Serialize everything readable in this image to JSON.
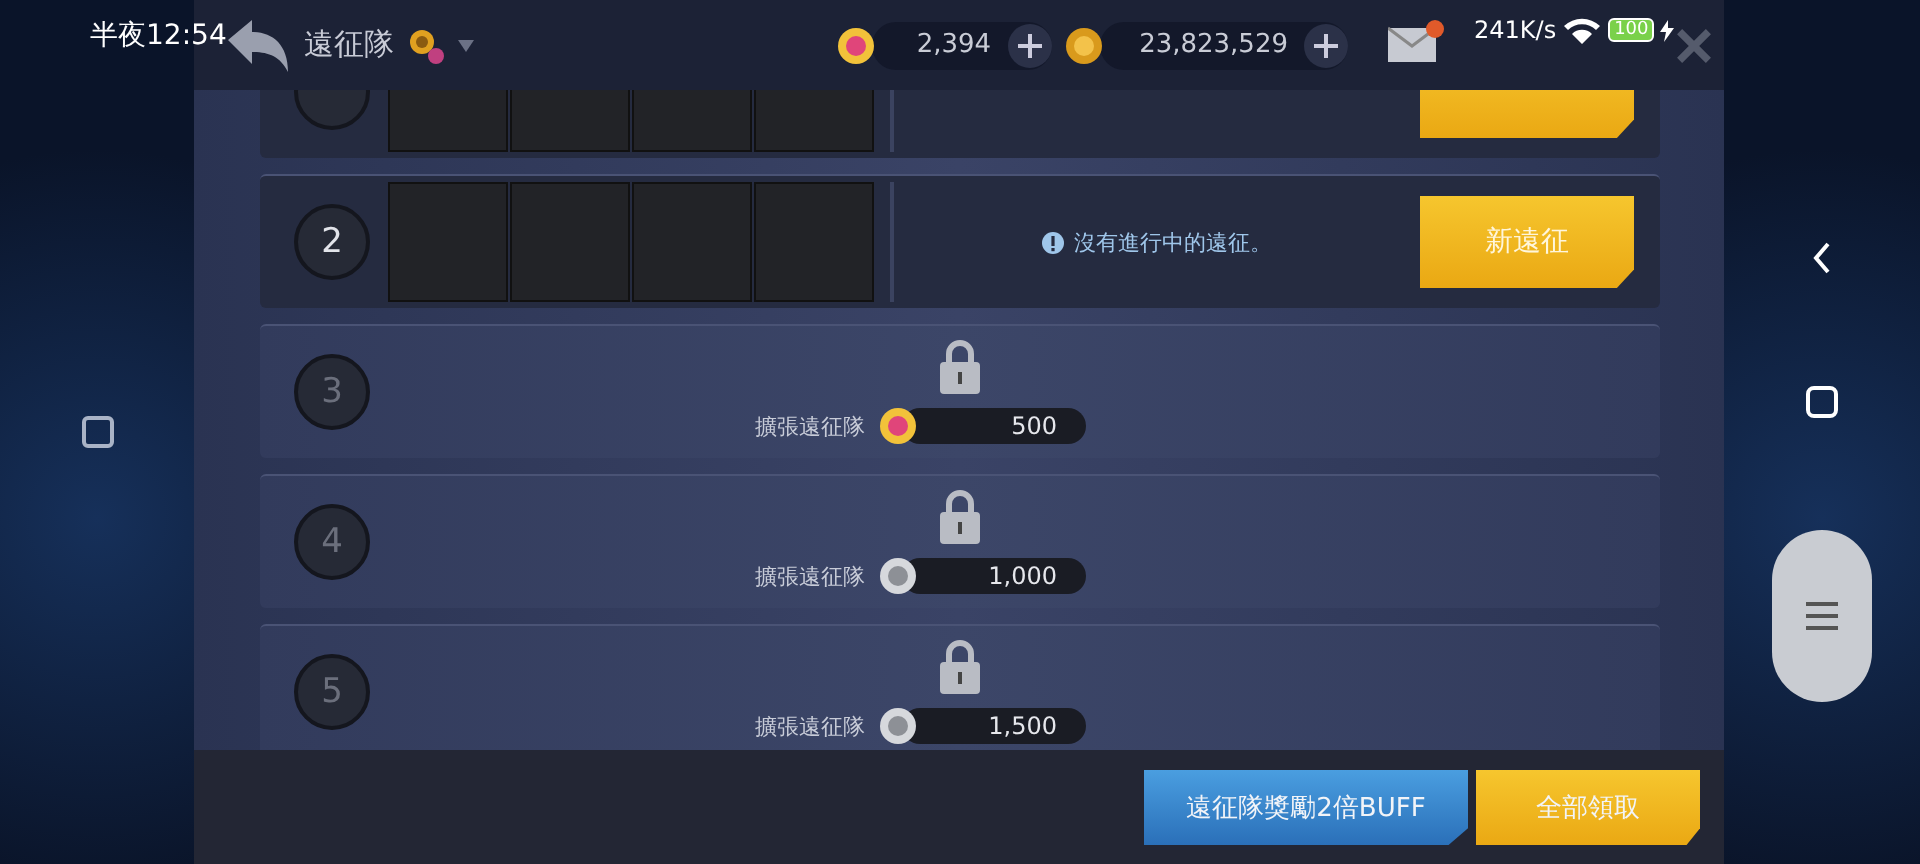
{
  "status_bar": {
    "time": "半夜12:54",
    "speed": "241K/s",
    "battery": "100"
  },
  "header": {
    "title": "遠征隊",
    "currencies": [
      {
        "kind": "gem",
        "amount": "2,394"
      },
      {
        "kind": "gold",
        "amount": "23,823,529"
      }
    ],
    "mail_unread": true
  },
  "rows": [
    {
      "kind": "open"
    },
    {
      "kind": "open",
      "number": "2",
      "status": "沒有進行中的遠征。",
      "button": "新遠征"
    },
    {
      "kind": "locked",
      "number": "3",
      "label": "擴張遠征隊",
      "cost": {
        "kind": "gem",
        "amount": "500"
      }
    },
    {
      "kind": "locked",
      "number": "4",
      "label": "擴張遠征隊",
      "cost": {
        "kind": "silver",
        "amount": "1,000"
      }
    },
    {
      "kind": "locked",
      "number": "5",
      "label": "擴張遠征隊",
      "cost": {
        "kind": "silver",
        "amount": "1,500"
      }
    }
  ],
  "footer_buttons": [
    {
      "kind": "buff",
      "label": "遠征隊獎勵2倍BUFF"
    },
    {
      "kind": "claim",
      "label": "全部領取"
    }
  ]
}
